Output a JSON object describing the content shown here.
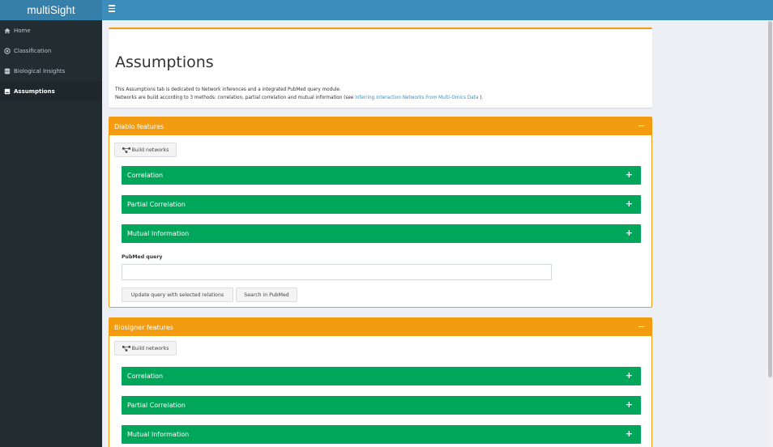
{
  "app": {
    "title": "multiSight"
  },
  "sidebar": {
    "items": [
      {
        "label": "Home",
        "icon": "home-icon"
      },
      {
        "label": "Classification",
        "icon": "target-icon"
      },
      {
        "label": "Biological Insights",
        "icon": "database-icon"
      },
      {
        "label": "Assumptions",
        "icon": "book-icon",
        "active": true
      }
    ]
  },
  "intro": {
    "title": "Assumptions",
    "line1": "This Assumptions tab is dedicated to Network inferences and a integrated PubMed query module.",
    "line2_prefix": "Networks are build according to 3 methods: correlation, partial correlation and mutual information (see ",
    "line2_link": "Inferring Interaction Networks From Multi-Omics Data",
    "line2_suffix": " )."
  },
  "diablo": {
    "title": "Diablo features",
    "collapse": "−",
    "build_label": "Build networks",
    "sections": [
      {
        "label": "Correlation",
        "toggle": "+"
      },
      {
        "label": "Partial Correlation",
        "toggle": "+"
      },
      {
        "label": "Mutual Information",
        "toggle": "+"
      }
    ],
    "pubmed_label": "PubMed query",
    "pubmed_value": "",
    "update_label": "Update query with selected relations",
    "search_label": "Search in PubMed"
  },
  "biosigner": {
    "title": "Biosigner features",
    "collapse": "−",
    "build_label": "Build networks",
    "sections": [
      {
        "label": "Correlation",
        "toggle": "+"
      },
      {
        "label": "Partial Correlation",
        "toggle": "+"
      },
      {
        "label": "Mutual Information",
        "toggle": "+"
      }
    ]
  },
  "colors": {
    "header": "#3c8dbc",
    "logo": "#367fa9",
    "sidebar": "#222d32",
    "warning": "#f39c12",
    "success": "#00a65a"
  }
}
